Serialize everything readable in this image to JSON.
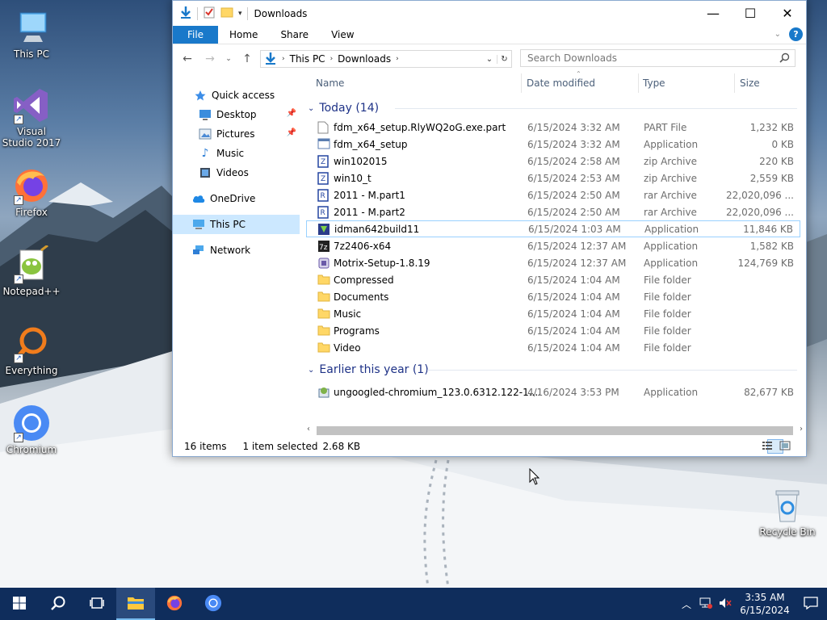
{
  "desktop": {
    "icons": [
      {
        "label": "This PC"
      },
      {
        "label": "Visual Studio 2017"
      },
      {
        "label": "Firefox"
      },
      {
        "label": "Notepad++"
      },
      {
        "label": "Everything"
      },
      {
        "label": "Chromium"
      },
      {
        "label": "Recycle Bin"
      }
    ]
  },
  "window": {
    "title": "Downloads",
    "ribbon_tabs": [
      "File",
      "Home",
      "Share",
      "View"
    ],
    "breadcrumb": [
      "This PC",
      "Downloads"
    ],
    "search_placeholder": "Search Downloads",
    "nav": [
      {
        "label": "Quick access"
      },
      {
        "label": "Desktop"
      },
      {
        "label": "Pictures"
      },
      {
        "label": "Music"
      },
      {
        "label": "Videos"
      },
      {
        "label": "OneDrive"
      },
      {
        "label": "This PC"
      },
      {
        "label": "Network"
      }
    ],
    "columns": [
      "Name",
      "Date modified",
      "Type",
      "Size"
    ],
    "groups": [
      {
        "header": "Today (14)",
        "files": [
          {
            "name": "fdm_x64_setup.RlyWQ2oG.exe.part",
            "date": "6/15/2024 3:32 AM",
            "type": "PART File",
            "size": "1,232 KB"
          },
          {
            "name": "fdm_x64_setup",
            "date": "6/15/2024 3:32 AM",
            "type": "Application",
            "size": "0 KB"
          },
          {
            "name": "win102015",
            "date": "6/15/2024 2:58 AM",
            "type": "zip Archive",
            "size": "220 KB"
          },
          {
            "name": "win10_t",
            "date": "6/15/2024 2:53 AM",
            "type": "zip Archive",
            "size": "2,559 KB"
          },
          {
            "name": "2011 - M.part1",
            "date": "6/15/2024 2:50 AM",
            "type": "rar Archive",
            "size": "22,020,096 ..."
          },
          {
            "name": "2011 - M.part2",
            "date": "6/15/2024 2:50 AM",
            "type": "rar Archive",
            "size": "22,020,096 ..."
          },
          {
            "name": "idman642build11",
            "date": "6/15/2024 1:03 AM",
            "type": "Application",
            "size": "11,846 KB"
          },
          {
            "name": "7z2406-x64",
            "date": "6/15/2024 12:37 AM",
            "type": "Application",
            "size": "1,582 KB"
          },
          {
            "name": "Motrix-Setup-1.8.19",
            "date": "6/15/2024 12:37 AM",
            "type": "Application",
            "size": "124,769 KB"
          },
          {
            "name": "Compressed",
            "date": "6/15/2024 1:04 AM",
            "type": "File folder",
            "size": ""
          },
          {
            "name": "Documents",
            "date": "6/15/2024 1:04 AM",
            "type": "File folder",
            "size": ""
          },
          {
            "name": "Music",
            "date": "6/15/2024 1:04 AM",
            "type": "File folder",
            "size": ""
          },
          {
            "name": "Programs",
            "date": "6/15/2024 1:04 AM",
            "type": "File folder",
            "size": ""
          },
          {
            "name": "Video",
            "date": "6/15/2024 1:04 AM",
            "type": "File folder",
            "size": ""
          }
        ]
      },
      {
        "header": "Earlier this year (1)",
        "files": [
          {
            "name": "ungoogled-chromium_123.0.6312.122-1....",
            "date": "4/16/2024 3:53 PM",
            "type": "Application",
            "size": "82,677 KB"
          }
        ]
      }
    ],
    "status": {
      "count": "16 items",
      "selected": "1 item selected",
      "size": "2.68 KB"
    }
  },
  "taskbar": {
    "time": "3:35 AM",
    "date": "6/15/2024"
  },
  "colors": {
    "accent": "#1979ca",
    "taskbar": "#0f2d5c",
    "group_header": "#1e3287",
    "selection": "#cce8ff"
  }
}
